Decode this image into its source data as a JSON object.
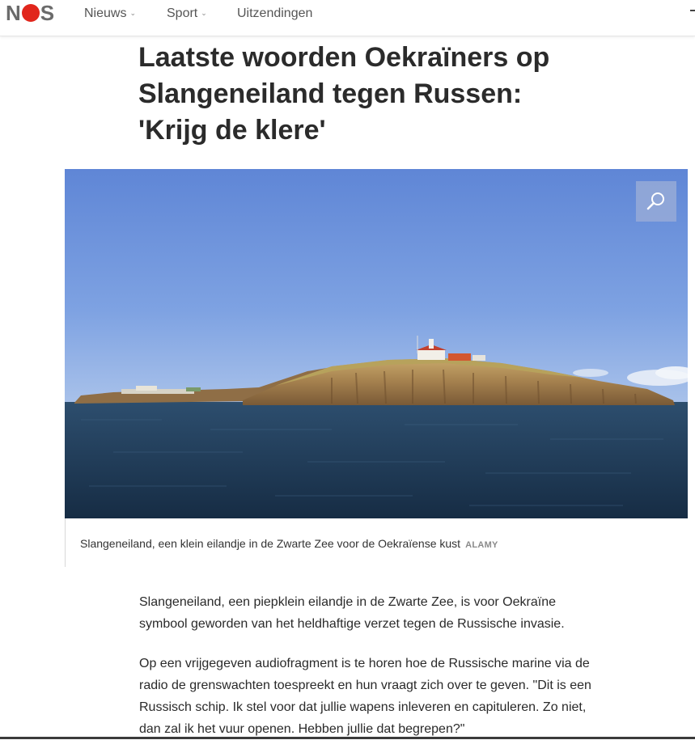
{
  "header": {
    "logo_text": "NOS",
    "nav": [
      {
        "label": "Nieuws",
        "has_dropdown": true
      },
      {
        "label": "Sport",
        "has_dropdown": true
      },
      {
        "label": "Uitzendingen",
        "has_dropdown": false
      }
    ]
  },
  "article": {
    "title_lines": [
      "Laatste woorden Oekraïners op",
      "Slangeneiland tegen Russen:",
      "'Krijg de klere'"
    ],
    "image": {
      "zoom_icon": "magnifier-icon",
      "caption": "Slangeneiland, een klein eilandje in de Zwarte Zee voor de Oekraïense kust",
      "credit": "ALAMY"
    },
    "paragraphs": [
      [
        "Slangeneiland, een piepklein eilandje in de Zwarte Zee, is voor Oekraïne",
        "symbool geworden van het heldhaftige verzet tegen de Russische invasie."
      ],
      [
        "Op een vrijgegeven audiofragment is te horen hoe de Russische marine via de",
        "radio de grenswachten toespreekt en hun vraagt zich over te geven. \"Dit is een",
        "Russisch schip. Ik stel voor dat jullie wapens inleveren en capituleren. Zo niet,",
        "dan zal ik het vuur openen. Hebben jullie dat begrepen?\""
      ]
    ]
  },
  "colors": {
    "brand_red": "#e1261c",
    "logo_grey": "#6b6b6b",
    "sky": "#6f95dc",
    "sea": "#1f3a55"
  }
}
